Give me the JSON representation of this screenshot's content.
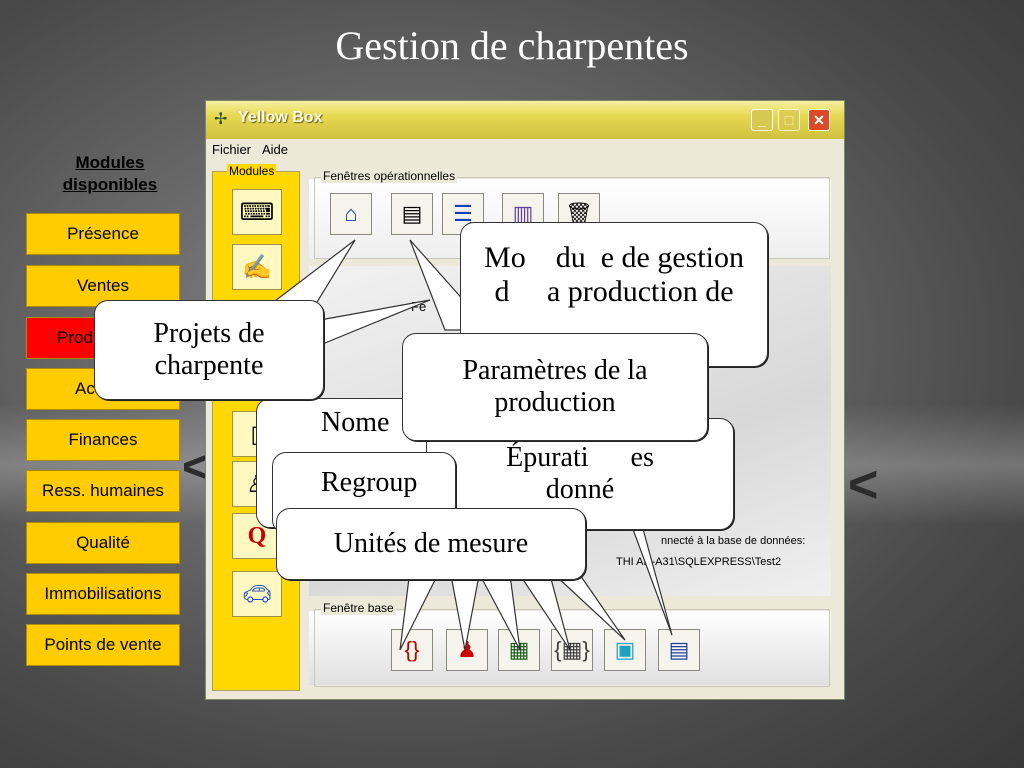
{
  "slide": {
    "title": "Gestion de charpentes"
  },
  "modules_list": {
    "heading_line1": "Modules",
    "heading_line2": "disponibles",
    "items": [
      {
        "label": "Présence",
        "active": false
      },
      {
        "label": "Ventes",
        "active": false
      },
      {
        "label": "Prod",
        "active": true
      },
      {
        "label": "Ac",
        "active": false
      },
      {
        "label": "Finances",
        "active": false
      },
      {
        "label": "Ress. humaines",
        "active": false
      },
      {
        "label": "Qualité",
        "active": false
      },
      {
        "label": "Immobilisations",
        "active": false
      },
      {
        "label": "Points de vente",
        "active": false
      }
    ]
  },
  "window": {
    "title": "Yellow Box",
    "menu": {
      "file": "Fichier",
      "help": "Aide"
    },
    "modules_group_label": "Modules",
    "ops_group_label": "Fenêtres opérationnelles",
    "base_group_label": "Fenêtre   base",
    "center_label": "Fe",
    "connection_label": "nnecté à la base de données:",
    "connection_server": "THI     AD-A31\\SQLEXPRESS\\Test2",
    "controls": {
      "minimize": "_",
      "maximize": "□",
      "close": "✕"
    }
  },
  "callouts": {
    "module_gestion": "Module de gestion de la production de charpentes",
    "module_gestion_l1": "Mo    du  e de gestion",
    "module_gestion_l2": "d     a production de",
    "projets_l1": "Projets de",
    "projets_l2": "charpente",
    "parametres_l1": "Paramètres de la",
    "parametres_l2": "production",
    "nome_l1": "Nome",
    "epuration_l1": "Épurati      es",
    "epuration_l2": "donné",
    "regroup": "Regroup",
    "unites": "Unités de mesure"
  },
  "colors": {
    "module_btn": "#ffcc00",
    "module_btn_active": "#ff0000",
    "window_title": "#e6d850"
  }
}
